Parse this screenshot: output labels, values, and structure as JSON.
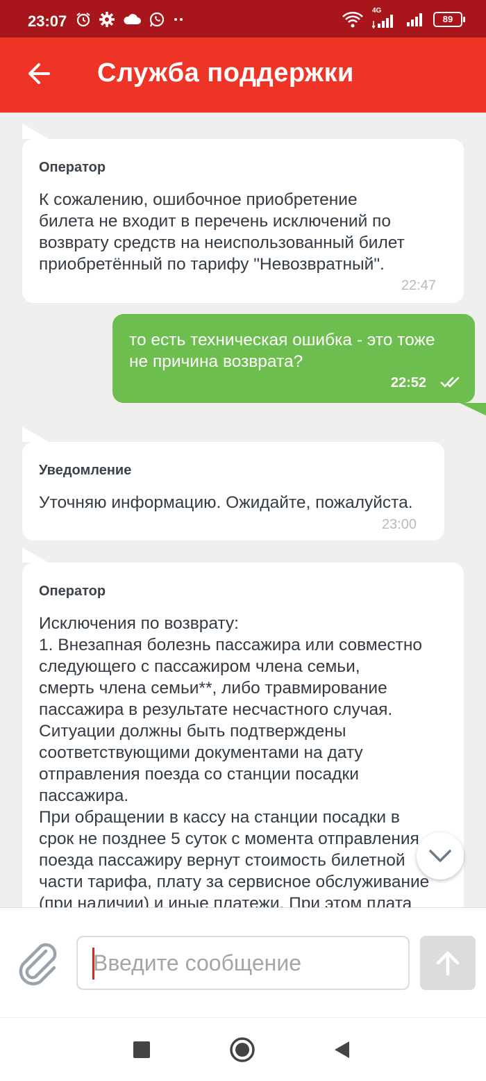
{
  "status_bar": {
    "time": "23:07",
    "battery": "89",
    "network": "4G",
    "icons_left": [
      "alarm-icon",
      "settings-icon",
      "cloud-icon",
      "whatsapp-icon",
      "more-dots-icon"
    ],
    "icons_right": [
      "wifi-icon",
      "signal-icon",
      "signal-icon",
      "battery-icon"
    ]
  },
  "header": {
    "title": "Служба поддержки",
    "background": "#ee3427",
    "status_background": "#a8151b"
  },
  "messages": [
    {
      "direction": "in",
      "sender": "Оператор",
      "text": "К сожалению, ошибочное приобретение\nбилета не входит в перечень исключений по\nвозврату средств на неиспользованный билет\nприобретённый по тарифу \"Невозвратный\".",
      "time": "22:47"
    },
    {
      "direction": "out",
      "text": "то есть техническая ошибка - это тоже\nне причина возврата?",
      "time": "22:52",
      "status": "read"
    },
    {
      "direction": "in",
      "sender": "Уведомление",
      "text": "Уточняю информацию. Ожидайте, пожалуйста.",
      "time": "23:00"
    },
    {
      "direction": "in",
      "sender": "Оператор",
      "text": "Исключения по возврату:\n1. Внезапная болезнь пассажира или совместно\nследующего с пассажиром члена семьи,\nсмерть члена семьи**, либо травмирование\nпассажира в результате несчастного случая.\nСитуации должны быть подтверждены\nсоответствующими документами на дату\nотправления поезда со станции посадки\nпассажира.\nПри обращении в кассу на станции посадки в\nсрок не позднее 5 суток с момента отправления\nпоезда пассажиру вернут стоимость билетной\nчасти тарифа, плату за сервисное обслуживание\n(при наличии) и иные платежи. При этом плата"
    }
  ],
  "composer": {
    "placeholder": "Введите сообщение"
  },
  "colors": {
    "outgoing_bubble": "#6dbd4f",
    "incoming_bubble": "#ffffff",
    "chat_background": "#efefed"
  },
  "nav_bar": {
    "buttons": [
      "recents-square-icon",
      "home-circle-icon",
      "back-triangle-icon"
    ]
  }
}
